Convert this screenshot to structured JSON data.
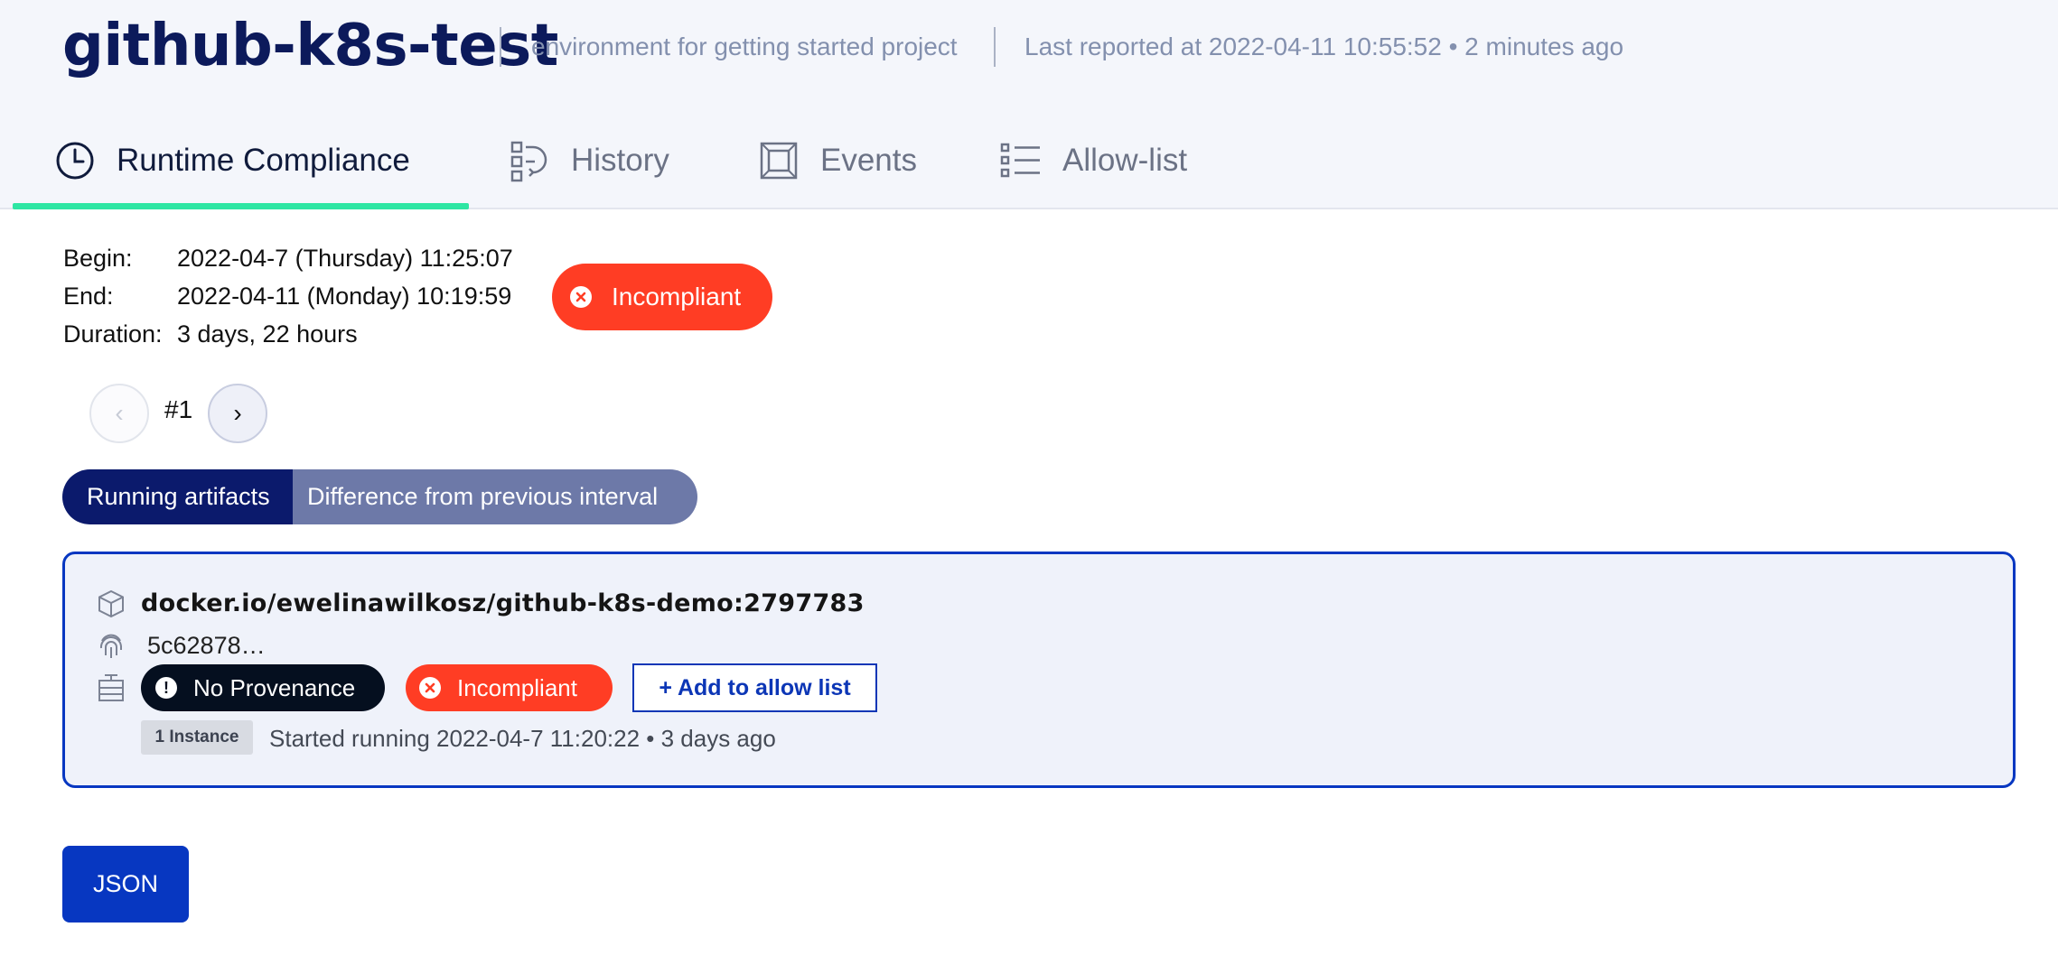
{
  "header": {
    "title": "github-k8s-test",
    "subtitle": "environment for getting started project",
    "last_reported": "Last reported at 2022-04-11 10:55:52 • 2 minutes ago"
  },
  "tabs": [
    {
      "label": "Runtime Compliance",
      "icon": "clock-icon",
      "active": true
    },
    {
      "label": "History",
      "icon": "history-icon",
      "active": false
    },
    {
      "label": "Events",
      "icon": "events-icon",
      "active": false
    },
    {
      "label": "Allow-list",
      "icon": "list-icon",
      "active": false
    }
  ],
  "interval": {
    "begin_label": "Begin:",
    "begin_value": "2022-04-7 (Thursday) 11:25:07",
    "end_label": "End:",
    "end_value": "2022-04-11 (Monday) 10:19:59",
    "duration_label": "Duration:",
    "duration_value": "3 days, 22 hours",
    "status": "Incompliant"
  },
  "pager": {
    "prev": "‹",
    "current": "#1",
    "next": "›"
  },
  "view_toggle": {
    "active": "Running artifacts",
    "inactive": "Difference from previous interval"
  },
  "artifact": {
    "name": "docker.io/ewelinawilkosz/github-k8s-demo:2797783",
    "digest": "5c62878…",
    "provenance": "No Provenance",
    "status": "Incompliant",
    "add_to_allow_list": "+ Add to allow list",
    "instances": "1 Instance",
    "started": "Started running 2022-04-7 11:20:22 • 3 days ago"
  },
  "json_button": "JSON",
  "colors": {
    "title": "#0c1a5b",
    "accent_tab": "#2ee6a3",
    "incompliant": "#ff3d24",
    "primary": "#0737c1",
    "segment_active": "#0b1a6c",
    "segment_inactive": "#6d79a8"
  }
}
